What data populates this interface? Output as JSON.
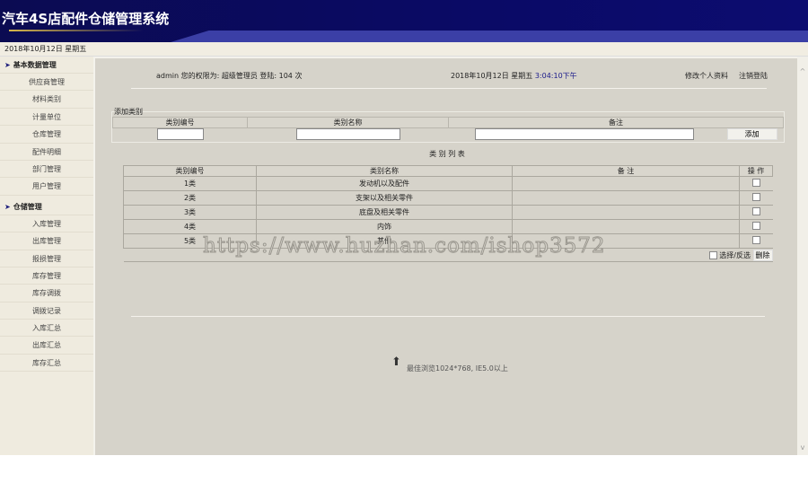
{
  "header": {
    "title": "汽车4S店配件仓储管理系统"
  },
  "datebar": {
    "date": "2018年10月12日 星期五"
  },
  "sidebar": {
    "groups": [
      {
        "title": "基本数据管理",
        "items": [
          "供应商管理",
          "材料类别",
          "计量单位",
          "仓库管理",
          "配件明细",
          "部门管理",
          "用户管理"
        ]
      },
      {
        "title": "仓储管理",
        "items": [
          "入库管理",
          "出库管理",
          "报损管理",
          "库存管理",
          "库存调拨",
          "调拨记录",
          "入库汇总",
          "出库汇总",
          "库存汇总"
        ]
      }
    ]
  },
  "topinfo": {
    "user": "admin 您的权限为: 超级管理员 登陆: 104 次",
    "date": "2018年10月12日 星期五",
    "time": "3:04:10下午",
    "edit_profile": "修改个人资料",
    "logout": "注销登陆"
  },
  "add_form": {
    "legend": "添加类别",
    "headers": [
      "类别编号",
      "类别名称",
      "备注"
    ],
    "add_button": "添加"
  },
  "list": {
    "title": "类 别 列 表",
    "headers": [
      "类别编号",
      "类别名称",
      "备 注",
      "操 作"
    ],
    "rows": [
      {
        "id": "1类",
        "name": "发动机以及配件",
        "note": ""
      },
      {
        "id": "2类",
        "name": "支架以及相关零件",
        "note": ""
      },
      {
        "id": "3类",
        "name": "底盘及相关零件",
        "note": ""
      },
      {
        "id": "4类",
        "name": "内饰",
        "note": ""
      },
      {
        "id": "5类",
        "name": "其他",
        "note": ""
      }
    ],
    "select_toggle": "选择/反选",
    "delete_button": "删除"
  },
  "footer": {
    "note": "最佳浏览1024*768, IE5.0以上"
  },
  "watermark": "https://www.huzhan.com/ishop3572",
  "colors": {
    "header": "#0b0b52",
    "main_bg": "#d6d3ca",
    "sidebar_bg": "#efebdf",
    "time": "#1a1a8a"
  }
}
